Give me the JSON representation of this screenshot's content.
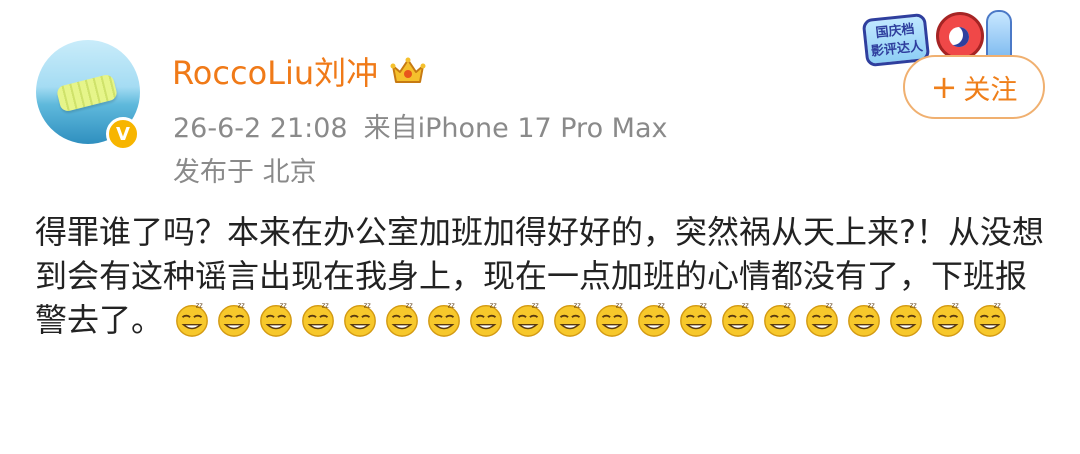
{
  "user": {
    "name": "RoccoLiu刘冲",
    "verified_badge": "V",
    "avatar_icon": "avatar-pool-float",
    "crown_icon": "vip-crown-icon"
  },
  "meta": {
    "time": "26-6-2 21:08",
    "source": "来自iPhone 17 Pro Max",
    "location": "发布于 北京"
  },
  "follow_button": {
    "plus": "+",
    "label": "关注"
  },
  "decoration": {
    "badge_text": "国庆档\n影评达人",
    "icon": "national-day-critic-badge"
  },
  "post": {
    "text": "得罪谁了吗？本来在办公室加班加得好好的，突然祸从天上来?！从没想到会有这种谣言出现在我身上，现在一点加班的心情都没有了，下班报警去了。",
    "emoji_name": "sleepy-emoji",
    "emoji_count": 20
  },
  "colors": {
    "username": "#f07a18",
    "meta": "#8a8a8a",
    "follow_border": "#f0b070",
    "follow_text": "#ef7f1a",
    "badge": "#f7b500",
    "text": "#222222"
  }
}
